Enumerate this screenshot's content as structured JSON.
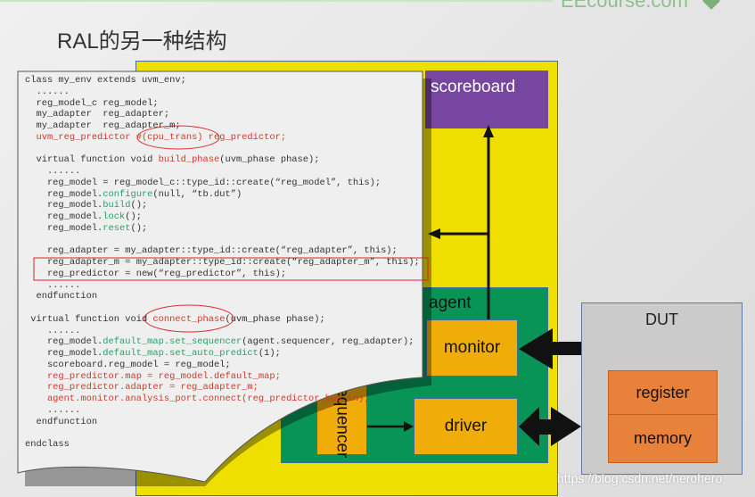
{
  "slide": {
    "title": "RAL的另一种结构",
    "brand": "EEcourse.com",
    "watermark": "https://blog.csdn.net/nerohero"
  },
  "diagram": {
    "scoreboard": "scoreboard",
    "agent": "agent",
    "monitor": "monitor",
    "driver": "driver",
    "sequencer": "sequencer",
    "dut": "DUT",
    "register": "register",
    "memory": "memory"
  },
  "colors": {
    "env": "#eedf00",
    "scoreboard": "#7646a0",
    "agent": "#079456",
    "component": "#f0ad0a",
    "dut": "#cbcbcb",
    "dut_block": "#e8823a",
    "code_red": "#d0392a",
    "code_green": "#2a9e6a"
  },
  "code": [
    [
      {
        "t": "class my_env extends uvm_env;"
      }
    ],
    [
      {
        "t": "  ......"
      }
    ],
    [
      {
        "t": "  reg_model_c reg_model;"
      }
    ],
    [
      {
        "t": "  my_adapter  reg_adapter;"
      }
    ],
    [
      {
        "t": "  my_adapter  reg_adapter_m;"
      }
    ],
    [
      {
        "t": "  uvm_reg_predictor #(cpu_trans) reg_predictor;",
        "c": "r"
      }
    ],
    [
      {
        "t": ""
      }
    ],
    [
      {
        "t": "  virtual function void "
      },
      {
        "t": "build_phase",
        "c": "r"
      },
      {
        "t": "(uvm_phase phase);"
      }
    ],
    [
      {
        "t": "    ......"
      }
    ],
    [
      {
        "t": "    reg_model = reg_model_c::type_id::create(“reg_model”, this);"
      }
    ],
    [
      {
        "t": "    reg_model."
      },
      {
        "t": "configure",
        "c": "g"
      },
      {
        "t": "(null, “tb.dut”)"
      }
    ],
    [
      {
        "t": "    reg_model."
      },
      {
        "t": "build",
        "c": "g"
      },
      {
        "t": "();"
      }
    ],
    [
      {
        "t": "    reg_model."
      },
      {
        "t": "lock",
        "c": "g"
      },
      {
        "t": "();"
      }
    ],
    [
      {
        "t": "    reg_model."
      },
      {
        "t": "reset",
        "c": "g"
      },
      {
        "t": "();"
      }
    ],
    [
      {
        "t": ""
      }
    ],
    [
      {
        "t": "    reg_adapter = my_adapter::type_id::create(“reg_adapter”, this);"
      }
    ],
    [
      {
        "t": "    reg_adapter_m = my_adapter::type_id::create(“reg_adapter_m”, this);"
      }
    ],
    [
      {
        "t": "    reg_predictor = new(“reg_predictor”, this);"
      }
    ],
    [
      {
        "t": "    ......"
      }
    ],
    [
      {
        "t": "  endfunction"
      }
    ],
    [
      {
        "t": ""
      }
    ],
    [
      {
        "t": " virtual function void "
      },
      {
        "t": "connect_phase",
        "c": "r"
      },
      {
        "t": "(uvm_phase phase);"
      }
    ],
    [
      {
        "t": "    ......"
      }
    ],
    [
      {
        "t": "    reg_model."
      },
      {
        "t": "default_map.set_sequencer",
        "c": "g"
      },
      {
        "t": "(agent.sequencer, reg_adapter);"
      }
    ],
    [
      {
        "t": "    reg_model."
      },
      {
        "t": "default_map.set_auto_predict",
        "c": "g"
      },
      {
        "t": "(1);"
      }
    ],
    [
      {
        "t": "    scoreboard.reg_model = reg_model;"
      }
    ],
    [
      {
        "t": "    reg_predictor.map = reg_model.default_map;",
        "c": "r"
      }
    ],
    [
      {
        "t": "    reg_predictor.adapter = reg_adapter_m;",
        "c": "r"
      }
    ],
    [
      {
        "t": "    agent.monitor.analysis_port.connect(reg_predictor.bus_in);",
        "c": "r"
      }
    ],
    [
      {
        "t": "    ......"
      }
    ],
    [
      {
        "t": "  endfunction"
      }
    ],
    [
      {
        "t": ""
      }
    ],
    [
      {
        "t": "endclass"
      }
    ]
  ]
}
